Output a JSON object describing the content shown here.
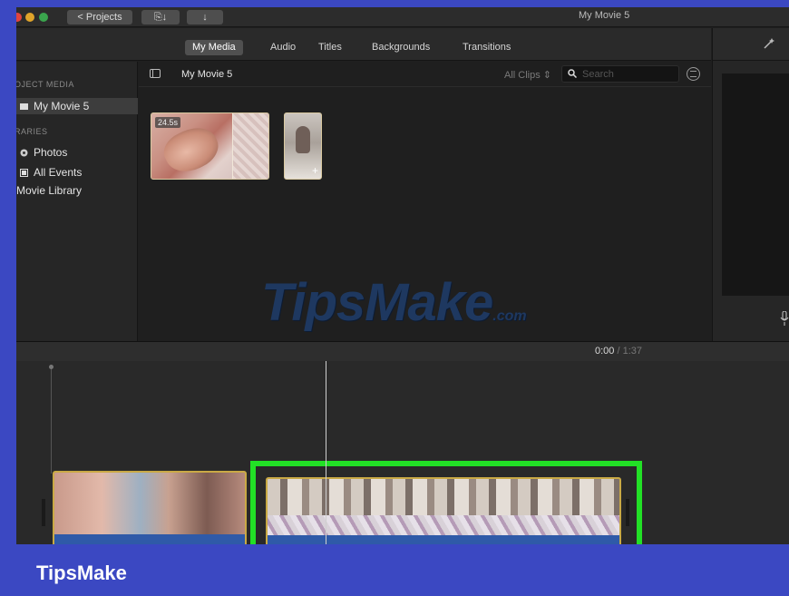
{
  "window": {
    "title": "My Movie 5"
  },
  "toolbar": {
    "projects_label": "< Projects",
    "share_label": "⎘↓",
    "download_label": "↓"
  },
  "tabs": [
    {
      "label": "My Media",
      "active": true
    },
    {
      "label": "Audio",
      "active": false
    },
    {
      "label": "Titles",
      "active": false
    },
    {
      "label": "Backgrounds",
      "active": false
    },
    {
      "label": "Transitions",
      "active": false
    }
  ],
  "sidebar": {
    "section_project": "OJECT MEDIA",
    "project_item": "My Movie 5",
    "section_libraries": "RARIES",
    "items": [
      {
        "label": "Photos",
        "icon": "flower-icon"
      },
      {
        "label": "All Events",
        "icon": "film-icon"
      },
      {
        "label": "Movie Library",
        "icon": "none"
      }
    ]
  },
  "browser": {
    "title": "My Movie 5",
    "filter_label": "All Clips ⇕",
    "search_placeholder": "Search",
    "clips": [
      {
        "duration": "24.5s"
      },
      {
        "duration": ""
      }
    ]
  },
  "watermark": {
    "main": "TipsMake",
    "suffix": ".com"
  },
  "timeline": {
    "current_time": "0:00",
    "separator": "/",
    "total_time": "1:37"
  },
  "brand": {
    "name": "TipsMake"
  },
  "colors": {
    "highlight": "#22e026",
    "accent_blue": "#3b48c2",
    "clip_border": "#c9a945"
  }
}
